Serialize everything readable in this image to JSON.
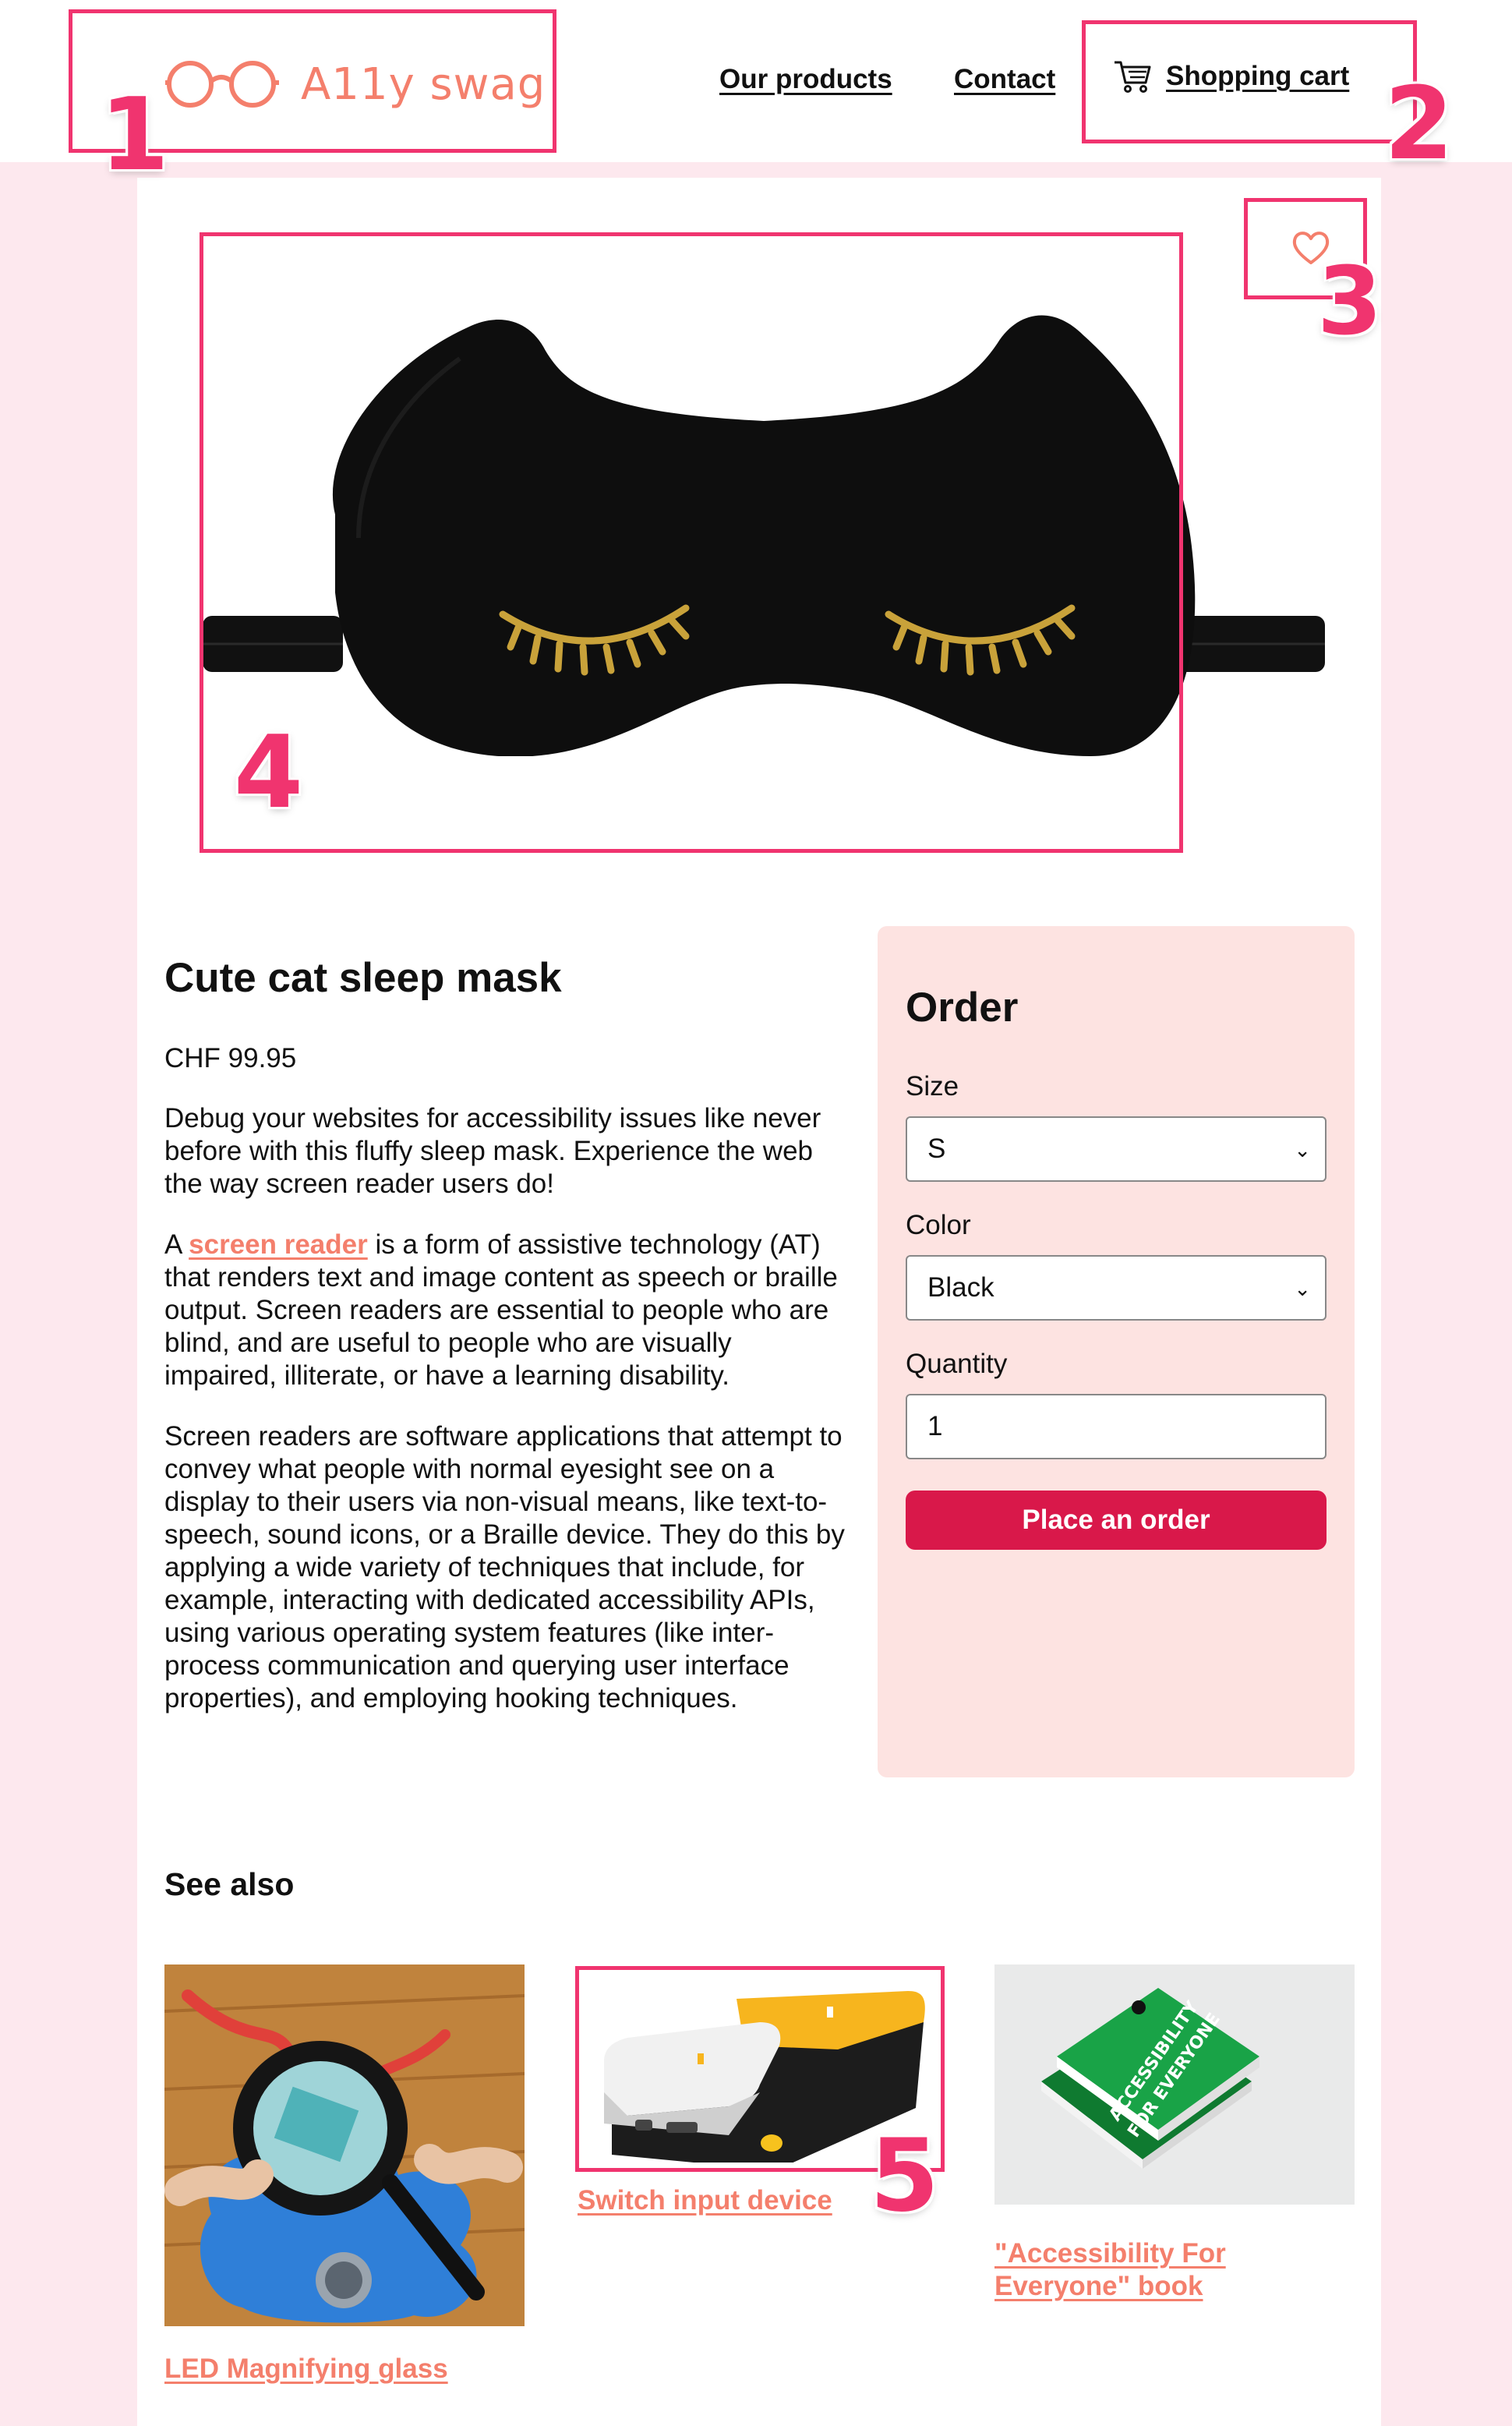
{
  "header": {
    "logo_text": "A11y swag",
    "nav": {
      "products": "Our products",
      "contact": "Contact",
      "cart": "Shopping cart"
    }
  },
  "annotations": [
    "1",
    "2",
    "3",
    "4",
    "5"
  ],
  "product": {
    "title": "Cute cat sleep mask",
    "price": "CHF 99.95",
    "intro": "Debug your websites for accessibility issues like never before with this fluffy sleep mask. Experience the web the way screen reader users do!",
    "para2_prefix": "A ",
    "para2_link": "screen reader",
    "para2_rest": " is a form of assistive technology (AT) that renders text and image content as speech or braille output. Screen readers are essential to people who are blind, and are useful to people who are visually impaired, illiterate, or have a learning disability.",
    "para3": "Screen readers are software applications that attempt to convey what people with normal eyesight see on a display to their users via non-visual means, like text-to-speech, sound icons, or a Braille device. They do this by applying a wide variety of techniques that include, for example, interacting with dedicated accessibility APIs, using various operating system features (like inter-process communication and querying user interface properties), and employing hooking techniques."
  },
  "order": {
    "heading": "Order",
    "size_label": "Size",
    "size_value": "S",
    "color_label": "Color",
    "color_value": "Black",
    "quantity_label": "Quantity",
    "quantity_value": "1",
    "button": "Place an order"
  },
  "see_also": {
    "heading": "See also",
    "items": [
      {
        "label": "LED Magnifying glass"
      },
      {
        "label": "Switch input device"
      },
      {
        "label": "\"Accessibility For Everyone\" book"
      }
    ]
  },
  "colors": {
    "accent_pink": "#f0346f",
    "logo_coral": "#f47f6c",
    "order_bg": "#fde3e1",
    "button_red": "#d9184a",
    "page_bg": "#fde8ee"
  }
}
